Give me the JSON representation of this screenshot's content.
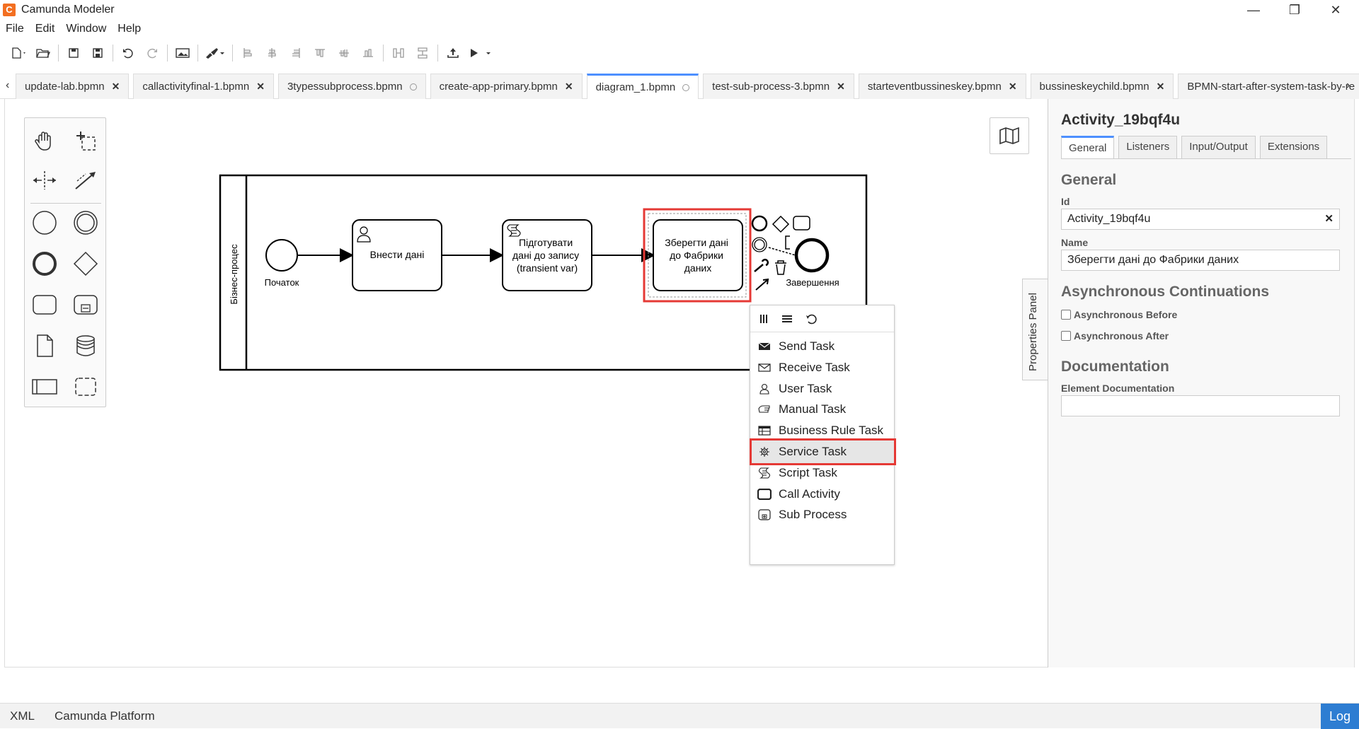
{
  "window": {
    "title": "Camunda Modeler",
    "minimize": "—",
    "restore": "❐",
    "close": "✕"
  },
  "menu": [
    "File",
    "Edit",
    "Window",
    "Help"
  ],
  "tabs": [
    {
      "label": "update-lab.bpmn",
      "state": "close"
    },
    {
      "label": "callactivityfinal-1.bpmn",
      "state": "close"
    },
    {
      "label": "3typessubprocess.bpmn",
      "state": "unsaved"
    },
    {
      "label": "create-app-primary.bpmn",
      "state": "close"
    },
    {
      "label": "diagram_1.bpmn",
      "state": "unsaved",
      "active": true
    },
    {
      "label": "test-sub-process-3.bpmn",
      "state": "close"
    },
    {
      "label": "starteventbussineskey.bpmn",
      "state": "close"
    },
    {
      "label": "bussineskeychild.bpmn",
      "state": "close"
    },
    {
      "label": "BPMN-start-after-system-task-by-re",
      "state": "none"
    }
  ],
  "diagram": {
    "pool_label": "Бізнес-процес",
    "start_event_label": "Початок",
    "task1": "Внести дані",
    "task2_lines": [
      "Підготувати",
      "дані до запису",
      "(transient var)"
    ],
    "task3_lines": [
      "Зберегти дані",
      "до Фабрики",
      "даних"
    ],
    "end_event_label": "Завершення"
  },
  "context_menu": {
    "items": [
      {
        "label": "Send Task",
        "icon": "send-task-icon"
      },
      {
        "label": "Receive Task",
        "icon": "receive-task-icon"
      },
      {
        "label": "User Task",
        "icon": "user-task-icon"
      },
      {
        "label": "Manual Task",
        "icon": "manual-task-icon"
      },
      {
        "label": "Business Rule Task",
        "icon": "business-rule-task-icon"
      },
      {
        "label": "Service Task",
        "icon": "service-task-icon",
        "highlighted": true
      },
      {
        "label": "Script Task",
        "icon": "script-task-icon"
      },
      {
        "label": "Call Activity",
        "icon": "call-activity-icon"
      },
      {
        "label": "Sub Process",
        "icon": "sub-process-icon"
      }
    ]
  },
  "properties": {
    "toggle_label": "Properties Panel",
    "title": "Activity_19bqf4u",
    "tabs": [
      "General",
      "Listeners",
      "Input/Output",
      "Extensions"
    ],
    "general_heading": "General",
    "id_label": "Id",
    "id_value": "Activity_19bqf4u",
    "name_label": "Name",
    "name_value": "Зберегти дані до Фабрики даних",
    "async_heading": "Asynchronous Continuations",
    "async_before": "Asynchronous Before",
    "async_after": "Asynchronous After",
    "doc_heading": "Documentation",
    "doc_label": "Element Documentation"
  },
  "statusbar": {
    "xml": "XML",
    "platform": "Camunda Platform",
    "log": "Log"
  }
}
